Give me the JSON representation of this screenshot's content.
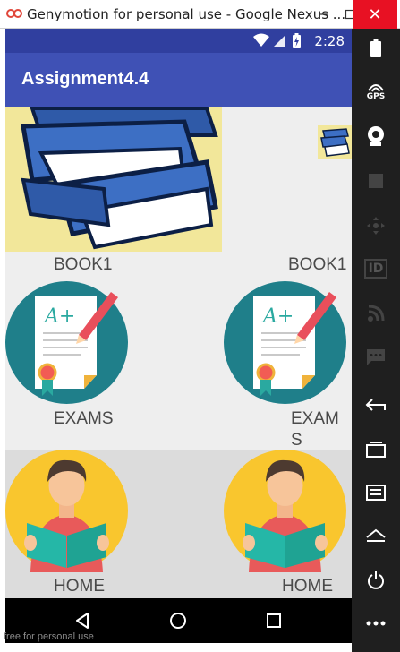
{
  "window": {
    "title": "Genymotion for personal use - Google Nexus ...",
    "logo_icon": "genymotion-logo-icon",
    "minimize_icon": "minimize-icon",
    "maximize_icon": "maximize-icon",
    "close_label": "✕"
  },
  "status_bar": {
    "time": "2:28",
    "icons": [
      "wifi-icon",
      "signal-icon",
      "battery-charging-icon"
    ]
  },
  "app_bar": {
    "title": "Assignment4.4"
  },
  "grid": {
    "items": [
      {
        "label": "BOOK1",
        "icon": "books-stack-icon"
      },
      {
        "label": "BOOK1",
        "icon": "books-stack-icon"
      },
      {
        "label": "EXAMS",
        "icon": "exam-paper-icon"
      },
      {
        "label": "EXAM",
        "label_line2": "S",
        "icon": "exam-paper-icon"
      },
      {
        "label": "HOME",
        "icon": "reading-person-icon"
      },
      {
        "label": "HOME",
        "icon": "reading-person-icon"
      }
    ]
  },
  "nav_bar": {
    "back_icon": "back-icon",
    "home_icon": "home-icon",
    "recents_icon": "recents-icon"
  },
  "side_toolbar": {
    "gps_label": "GPS",
    "id_label": "ID",
    "icons": [
      "battery-icon",
      "gps-icon",
      "camera-icon",
      "media-icon",
      "dpad-icon",
      "id-icon",
      "rss-icon",
      "sms-icon",
      "back-icon",
      "recents-icon",
      "menu-icon",
      "home-icon",
      "power-icon",
      "more-icon"
    ]
  },
  "watermark": "free for personal use",
  "colors": {
    "status_bar": "#303f9f",
    "app_bar": "#3f51b5",
    "close_button": "#e81123",
    "exam_circle": "#1f7f8a",
    "home_circle": "#f9c62e"
  }
}
